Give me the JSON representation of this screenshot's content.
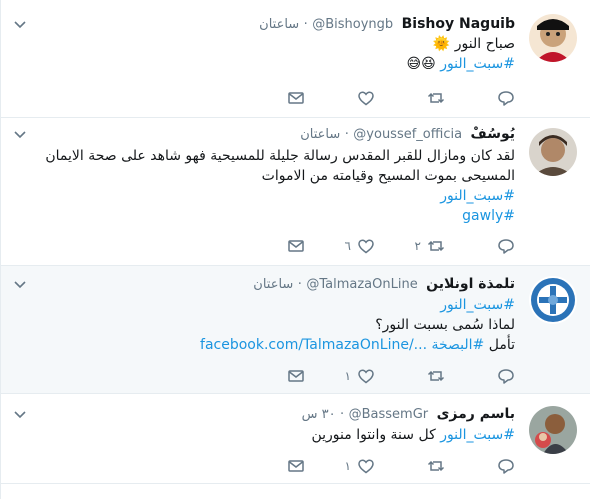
{
  "tweets": [
    {
      "name": "Bishoy Naguib",
      "handle": "@Bishoyngb",
      "dot": "·",
      "time": "ساعتان",
      "lines": [
        "صباح النور 🌞"
      ],
      "tags": [
        "#سبت_النور"
      ],
      "emoji": "😆😅",
      "reply_count": "",
      "retweet_count": "",
      "like_count": ""
    },
    {
      "name": "يُوسُفْ",
      "handle": "@youssef_officia",
      "dot": "·",
      "time": "ساعتان",
      "lines": [
        "لقد كان ومازال للقبر المقدس رسالة جليلة للمسيحية فهو شاهد على صحة الايمان",
        "المسيحى بموت المسيح وقيامته من الاموات"
      ],
      "tags": [
        "#سبت_النور",
        "#gawly"
      ],
      "reply_count": "",
      "retweet_count": "٢",
      "like_count": "٦"
    },
    {
      "name": "تلمذة اونلاين",
      "handle": "@TalmazaOnLine",
      "dot": "·",
      "time": "ساعتان",
      "lines": [
        "لماذا سُمى بسبت النور؟"
      ],
      "tags": [
        "#سبت_النور"
      ],
      "prefix": "تأمل",
      "link_tag": "#البصخة",
      "link": "facebook.com/TalmazaOnLine/...",
      "reply_count": "",
      "retweet_count": "",
      "like_count": "١"
    },
    {
      "name": "باسم رمزى",
      "handle": "@BassemGr",
      "dot": "·",
      "time": "٣٠ س",
      "tag_inline": "#سبت_النور",
      "text_after": "كل سنة وانتوا منورين",
      "reply_count": "",
      "retweet_count": "",
      "like_count": "١"
    }
  ]
}
